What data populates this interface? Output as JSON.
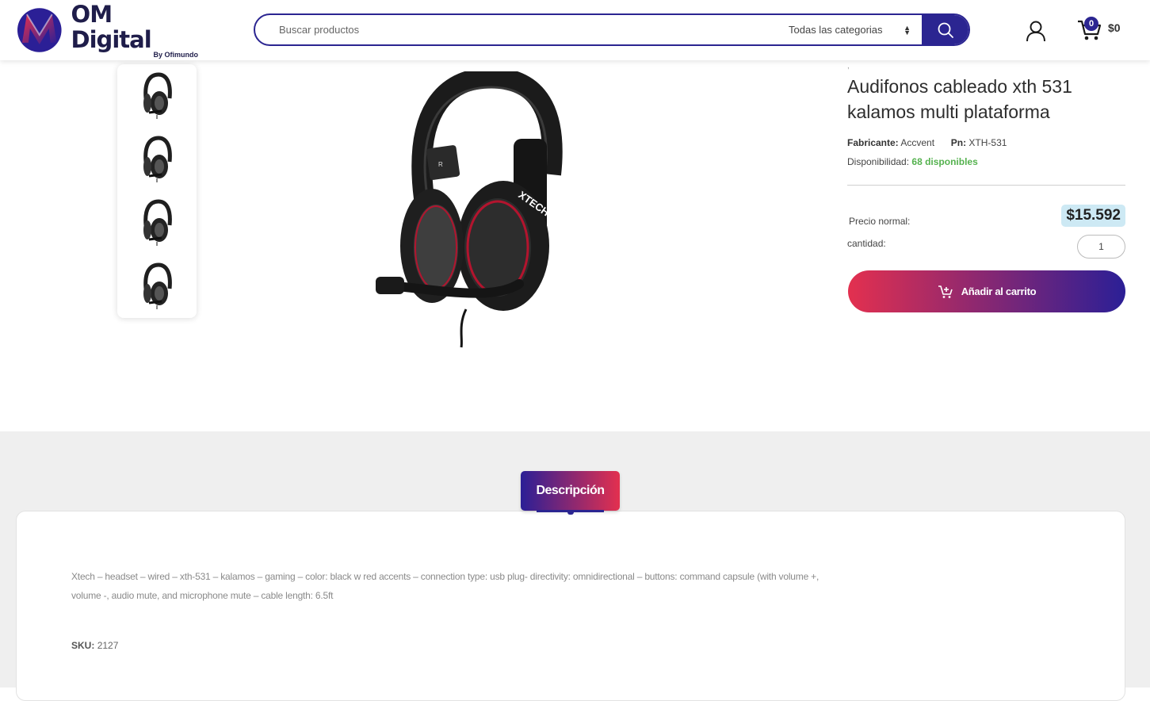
{
  "header": {
    "logo_title": "OM Digital",
    "logo_subtitle": "By Ofimundo",
    "search_placeholder": "Buscar productos",
    "category_selected": "Todas las categorias",
    "cart_count": "0",
    "cart_total": "$0"
  },
  "product": {
    "crumb": ",",
    "title": "Audifonos cableado xth 531 kalamos multi plataforma",
    "manufacturer_label": "Fabricante:",
    "manufacturer": "Accvent",
    "pn_label": "Pn:",
    "pn": "XTH-531",
    "availability_label": "Disponibilidad:",
    "availability": "68 disponibles",
    "price_label": "Precio normal:",
    "price": "$15.592",
    "quantity_label": "cantidad:",
    "quantity": "1",
    "add_to_cart": "Añadir al carrito",
    "brand_print": "XTECH",
    "ear_mark": "R"
  },
  "description": {
    "tab_label": "Descripción",
    "text": "Xtech – headset – wired – xth-531 – kalamos – gaming – color: black w red accents – connection type: usb plug- directivity: omnidirectional – buttons: command capsule (with volume +, volume -, audio mute, and microphone mute – cable length: 6.5ft",
    "sku_label": "SKU:",
    "sku": "2127"
  },
  "colors": {
    "brand_navy": "#2b2591",
    "accent_red": "#e3304f",
    "available_green": "#55b24f",
    "price_highlight": "#cde9f4"
  }
}
